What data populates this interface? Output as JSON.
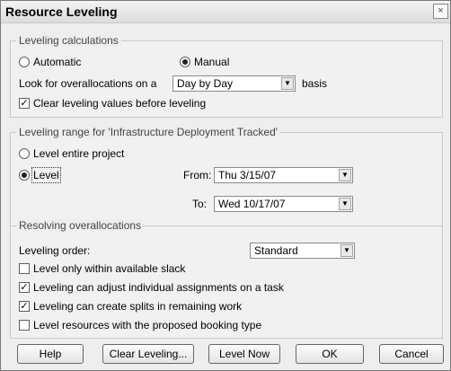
{
  "dialog": {
    "title": "Resource Leveling",
    "close_glyph": "×"
  },
  "calc": {
    "legend": "Leveling calculations",
    "automatic": {
      "label": "Automatic",
      "checked": false
    },
    "manual": {
      "label": "Manual",
      "checked": true
    },
    "overalloc_prefix": "Look for overallocations on a",
    "overalloc_value": "Day by Day",
    "overalloc_suffix": "basis",
    "clear_values": {
      "label": "Clear leveling values before leveling",
      "checked": true
    }
  },
  "range": {
    "legend": "Leveling range for 'Infrastructure Deployment Tracked'",
    "entire": {
      "label": "Level entire project",
      "checked": false
    },
    "level": {
      "label": "Level",
      "checked": true
    },
    "from_label": "From:",
    "from_value": "Thu 3/15/07",
    "to_label": "To:",
    "to_value": "Wed 10/17/07"
  },
  "resolve": {
    "legend": "Resolving overallocations",
    "order_label": "Leveling order:",
    "order_value": "Standard",
    "options": [
      {
        "label": "Level only within available slack",
        "checked": false
      },
      {
        "label": "Leveling can adjust individual assignments on a task",
        "checked": true
      },
      {
        "label": "Leveling can create splits in remaining work",
        "checked": true
      },
      {
        "label": "Level resources with the proposed booking type",
        "checked": false
      }
    ]
  },
  "buttons": {
    "help": "Help",
    "clear": "Clear Leveling...",
    "level_now": "Level Now",
    "ok": "OK",
    "cancel": "Cancel"
  },
  "icons": {
    "dropdown": "chevron-down-icon",
    "check": "✓"
  }
}
